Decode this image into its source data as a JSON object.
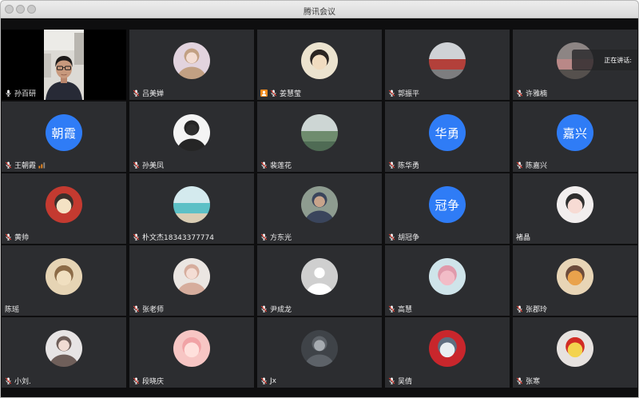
{
  "window": {
    "title": "腾讯会议"
  },
  "colors": {
    "avatar_blue": "#2f7cf6",
    "tile_background": "#2c2d30",
    "accent_orange": "#f28a1d",
    "muted_red": "#f04438"
  },
  "speaking": {
    "label": "正在讲话:"
  },
  "participants": [
    {
      "name": "孙百研",
      "mic": "mic-icon",
      "avatar": {
        "icon": "camera-feed"
      }
    },
    {
      "name": "吕美婵",
      "mic": "mic-muted-icon",
      "avatar": {
        "icon": "portrait-photo-avatar",
        "colors": [
          "#f3dcd2",
          "#c2a083",
          "#e2d3de"
        ]
      }
    },
    {
      "name": "姜慧莹",
      "badge": "host-icon",
      "mic": "mic-muted-icon",
      "avatar": {
        "icon": "cartoon-avatar",
        "colors": [
          "#f1dcc0",
          "#2b2522",
          "#ece3cf"
        ]
      }
    },
    {
      "name": "郭振平",
      "mic": "mic-muted-icon",
      "avatar": {
        "icon": "landscape-photo-avatar",
        "colors": [
          "#cfd2d6",
          "#b3403a",
          "#7d7d7f"
        ]
      }
    },
    {
      "name": "许雅楠",
      "mic": "mic-muted-icon",
      "avatar": {
        "icon": "landscape-photo-avatar",
        "colors": [
          "#8d8584",
          "#b98887",
          "#55504d"
        ]
      }
    },
    {
      "name": "王朝霞",
      "mic": "mic-muted-icon",
      "signal": "weak-signal-icon",
      "avatar": {
        "text": "朝霞"
      }
    },
    {
      "name": "孙美凤",
      "mic": "mic-muted-icon",
      "avatar": {
        "icon": "portrait-photo-avatar",
        "colors": [
          "#2f2f2f",
          "#252525",
          "#f4f4f4"
        ]
      }
    },
    {
      "name": "裴莲花",
      "mic": "mic-muted-icon",
      "avatar": {
        "icon": "landscape-photo-avatar",
        "colors": [
          "#cdd6d4",
          "#6f8c6e",
          "#4f6b54"
        ]
      }
    },
    {
      "name": "陈华勇",
      "mic": "mic-muted-icon",
      "avatar": {
        "text": "华勇"
      }
    },
    {
      "name": "陈嘉兴",
      "mic": "mic-muted-icon",
      "avatar": {
        "text": "嘉兴"
      }
    },
    {
      "name": "黄帅",
      "mic": "mic-muted-icon",
      "avatar": {
        "icon": "cartoon-avatar",
        "colors": [
          "#f4e2c4",
          "#3b302b",
          "#c43a30"
        ]
      }
    },
    {
      "name": "朴文杰18343377774",
      "mic": "mic-muted-icon",
      "avatar": {
        "icon": "landscape-photo-avatar",
        "colors": [
          "#d4eaee",
          "#5cc0c6",
          "#d9cdb4"
        ]
      }
    },
    {
      "name": "方东光",
      "mic": "mic-muted-icon",
      "avatar": {
        "icon": "portrait-photo-avatar",
        "colors": [
          "#c8a48b",
          "#3a455c",
          "#8e9c90"
        ]
      }
    },
    {
      "name": "胡冠争",
      "mic": "mic-muted-icon",
      "avatar": {
        "text": "冠争"
      }
    },
    {
      "name": "褚晶",
      "avatar": {
        "icon": "cartoon-avatar",
        "colors": [
          "#f7dbd4",
          "#2e2e2e",
          "#f2eeee"
        ]
      }
    },
    {
      "name": "陈瑶",
      "avatar": {
        "icon": "cartoon-avatar",
        "colors": [
          "#f0dfc0",
          "#8c6b47",
          "#e6d4b4"
        ]
      }
    },
    {
      "name": "张老师",
      "mic": "mic-muted-icon",
      "avatar": {
        "icon": "portrait-photo-avatar",
        "colors": [
          "#f4ddd4",
          "#d6ad9d",
          "#ebe6e2"
        ]
      }
    },
    {
      "name": "尹成龙",
      "mic": "mic-muted-icon",
      "avatar": {
        "icon": "default-user-avatar",
        "colors": [
          "#ffffff",
          "#ffffff",
          "#cfcfcf"
        ]
      }
    },
    {
      "name": "高慧",
      "mic": "mic-muted-icon",
      "avatar": {
        "icon": "cartoon-avatar",
        "colors": [
          "#f2bcc7",
          "#e09aab",
          "#cfe4ea"
        ]
      }
    },
    {
      "name": "张郡玲",
      "mic": "mic-muted-icon",
      "avatar": {
        "icon": "cartoon-avatar",
        "colors": [
          "#e9a24c",
          "#6c4b3b",
          "#e8d5b6"
        ]
      }
    },
    {
      "name": "小刘.",
      "mic": "mic-muted-icon",
      "avatar": {
        "icon": "portrait-photo-avatar",
        "colors": [
          "#f1dcd3",
          "#6f5f5a",
          "#e7e4e4"
        ]
      }
    },
    {
      "name": "段晓庆",
      "mic": "mic-muted-icon",
      "avatar": {
        "icon": "cartoon-avatar",
        "colors": [
          "#ffe0dc",
          "#f1a3a6",
          "#f7c6c4"
        ]
      }
    },
    {
      "name": "Jx",
      "mic": "mic-muted-icon",
      "avatar": {
        "icon": "portrait-photo-avatar",
        "colors": [
          "#a6abb0",
          "#5d6268",
          "#3f4348"
        ]
      }
    },
    {
      "name": "吴倩",
      "mic": "mic-muted-icon",
      "avatar": {
        "icon": "cartoon-avatar",
        "colors": [
          "#e9eef2",
          "#5f6e80",
          "#c9262c"
        ]
      }
    },
    {
      "name": "张寒",
      "mic": "mic-muted-icon",
      "avatar": {
        "icon": "cartoon-avatar",
        "colors": [
          "#f3d34e",
          "#d12b24",
          "#e7e2df"
        ]
      }
    }
  ]
}
